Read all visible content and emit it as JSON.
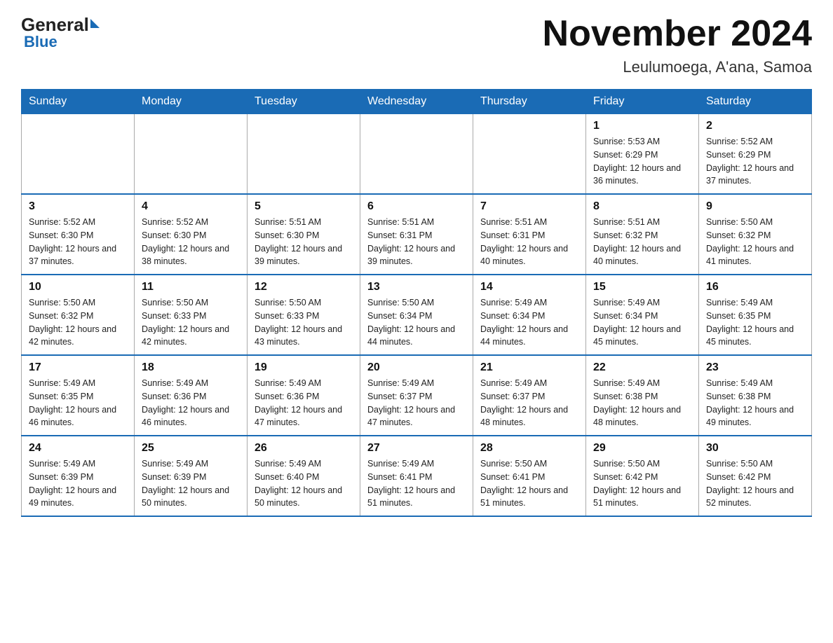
{
  "header": {
    "logo_general": "General",
    "logo_blue": "Blue",
    "month_title": "November 2024",
    "location": "Leulumoega, A'ana, Samoa"
  },
  "days_of_week": [
    "Sunday",
    "Monday",
    "Tuesday",
    "Wednesday",
    "Thursday",
    "Friday",
    "Saturday"
  ],
  "weeks": [
    [
      {
        "day": "",
        "info": ""
      },
      {
        "day": "",
        "info": ""
      },
      {
        "day": "",
        "info": ""
      },
      {
        "day": "",
        "info": ""
      },
      {
        "day": "",
        "info": ""
      },
      {
        "day": "1",
        "info": "Sunrise: 5:53 AM\nSunset: 6:29 PM\nDaylight: 12 hours and 36 minutes."
      },
      {
        "day": "2",
        "info": "Sunrise: 5:52 AM\nSunset: 6:29 PM\nDaylight: 12 hours and 37 minutes."
      }
    ],
    [
      {
        "day": "3",
        "info": "Sunrise: 5:52 AM\nSunset: 6:30 PM\nDaylight: 12 hours and 37 minutes."
      },
      {
        "day": "4",
        "info": "Sunrise: 5:52 AM\nSunset: 6:30 PM\nDaylight: 12 hours and 38 minutes."
      },
      {
        "day": "5",
        "info": "Sunrise: 5:51 AM\nSunset: 6:30 PM\nDaylight: 12 hours and 39 minutes."
      },
      {
        "day": "6",
        "info": "Sunrise: 5:51 AM\nSunset: 6:31 PM\nDaylight: 12 hours and 39 minutes."
      },
      {
        "day": "7",
        "info": "Sunrise: 5:51 AM\nSunset: 6:31 PM\nDaylight: 12 hours and 40 minutes."
      },
      {
        "day": "8",
        "info": "Sunrise: 5:51 AM\nSunset: 6:32 PM\nDaylight: 12 hours and 40 minutes."
      },
      {
        "day": "9",
        "info": "Sunrise: 5:50 AM\nSunset: 6:32 PM\nDaylight: 12 hours and 41 minutes."
      }
    ],
    [
      {
        "day": "10",
        "info": "Sunrise: 5:50 AM\nSunset: 6:32 PM\nDaylight: 12 hours and 42 minutes."
      },
      {
        "day": "11",
        "info": "Sunrise: 5:50 AM\nSunset: 6:33 PM\nDaylight: 12 hours and 42 minutes."
      },
      {
        "day": "12",
        "info": "Sunrise: 5:50 AM\nSunset: 6:33 PM\nDaylight: 12 hours and 43 minutes."
      },
      {
        "day": "13",
        "info": "Sunrise: 5:50 AM\nSunset: 6:34 PM\nDaylight: 12 hours and 44 minutes."
      },
      {
        "day": "14",
        "info": "Sunrise: 5:49 AM\nSunset: 6:34 PM\nDaylight: 12 hours and 44 minutes."
      },
      {
        "day": "15",
        "info": "Sunrise: 5:49 AM\nSunset: 6:34 PM\nDaylight: 12 hours and 45 minutes."
      },
      {
        "day": "16",
        "info": "Sunrise: 5:49 AM\nSunset: 6:35 PM\nDaylight: 12 hours and 45 minutes."
      }
    ],
    [
      {
        "day": "17",
        "info": "Sunrise: 5:49 AM\nSunset: 6:35 PM\nDaylight: 12 hours and 46 minutes."
      },
      {
        "day": "18",
        "info": "Sunrise: 5:49 AM\nSunset: 6:36 PM\nDaylight: 12 hours and 46 minutes."
      },
      {
        "day": "19",
        "info": "Sunrise: 5:49 AM\nSunset: 6:36 PM\nDaylight: 12 hours and 47 minutes."
      },
      {
        "day": "20",
        "info": "Sunrise: 5:49 AM\nSunset: 6:37 PM\nDaylight: 12 hours and 47 minutes."
      },
      {
        "day": "21",
        "info": "Sunrise: 5:49 AM\nSunset: 6:37 PM\nDaylight: 12 hours and 48 minutes."
      },
      {
        "day": "22",
        "info": "Sunrise: 5:49 AM\nSunset: 6:38 PM\nDaylight: 12 hours and 48 minutes."
      },
      {
        "day": "23",
        "info": "Sunrise: 5:49 AM\nSunset: 6:38 PM\nDaylight: 12 hours and 49 minutes."
      }
    ],
    [
      {
        "day": "24",
        "info": "Sunrise: 5:49 AM\nSunset: 6:39 PM\nDaylight: 12 hours and 49 minutes."
      },
      {
        "day": "25",
        "info": "Sunrise: 5:49 AM\nSunset: 6:39 PM\nDaylight: 12 hours and 50 minutes."
      },
      {
        "day": "26",
        "info": "Sunrise: 5:49 AM\nSunset: 6:40 PM\nDaylight: 12 hours and 50 minutes."
      },
      {
        "day": "27",
        "info": "Sunrise: 5:49 AM\nSunset: 6:41 PM\nDaylight: 12 hours and 51 minutes."
      },
      {
        "day": "28",
        "info": "Sunrise: 5:50 AM\nSunset: 6:41 PM\nDaylight: 12 hours and 51 minutes."
      },
      {
        "day": "29",
        "info": "Sunrise: 5:50 AM\nSunset: 6:42 PM\nDaylight: 12 hours and 51 minutes."
      },
      {
        "day": "30",
        "info": "Sunrise: 5:50 AM\nSunset: 6:42 PM\nDaylight: 12 hours and 52 minutes."
      }
    ]
  ]
}
